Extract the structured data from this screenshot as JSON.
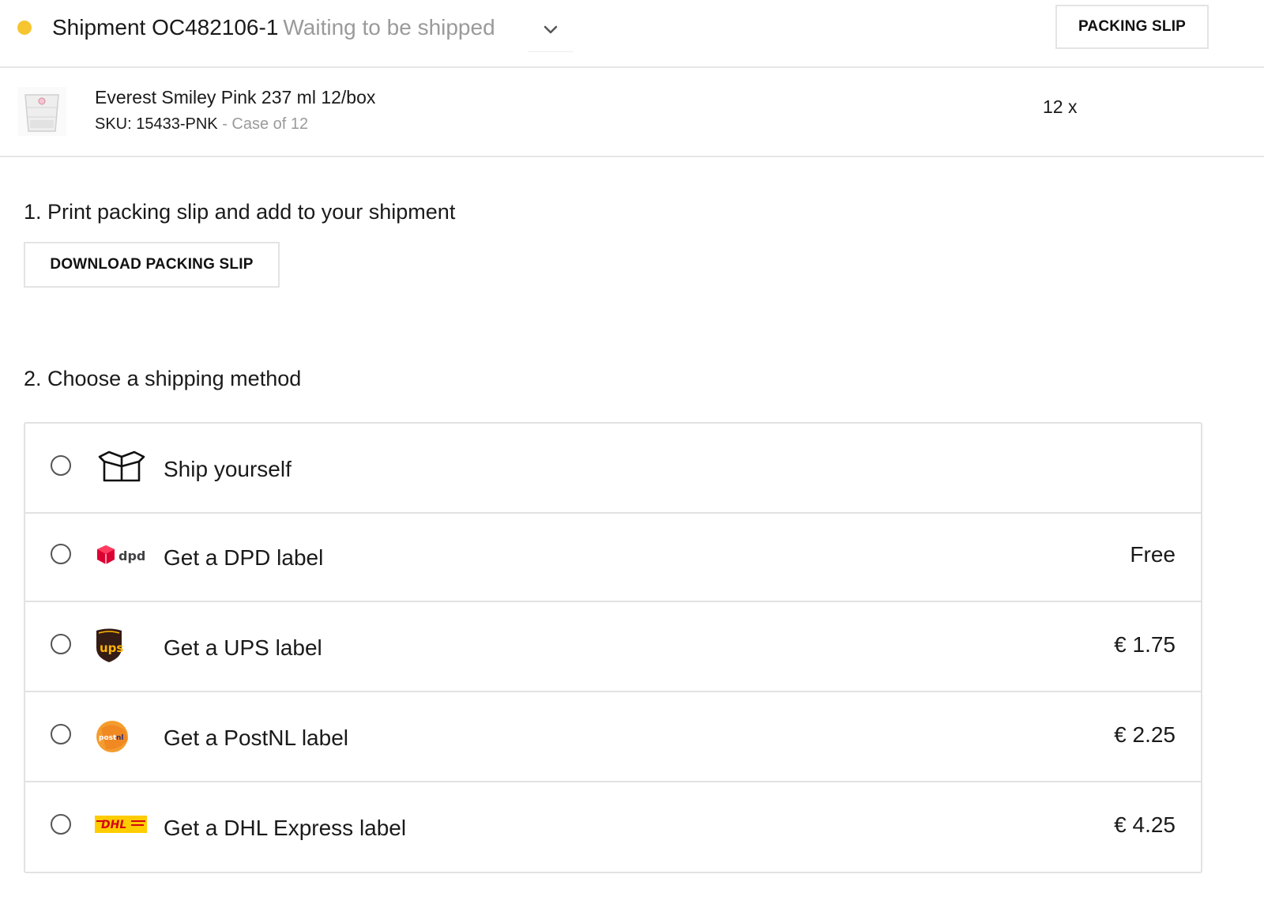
{
  "header": {
    "shipment_label": "Shipment OC482106-1",
    "status": "Waiting to be shipped",
    "status_color": "#f7c530",
    "packing_slip_button": "PACKING SLIP"
  },
  "product": {
    "name": "Everest Smiley Pink 237 ml 12/box",
    "sku": "SKU: 15433-PNK",
    "pack": " - Case of 12",
    "quantity": "12 x"
  },
  "steps": {
    "step1_title": "1. Print packing slip and add to your shipment",
    "download_button": "DOWNLOAD PACKING SLIP",
    "step2_title": "2. Choose a shipping method"
  },
  "shipping_options": [
    {
      "label": "Ship yourself",
      "price": "",
      "icon": "box-icon"
    },
    {
      "label": "Get a DPD label",
      "price": "Free",
      "icon": "dpd-logo"
    },
    {
      "label": "Get a UPS label",
      "price": "€ 1.75",
      "icon": "ups-logo"
    },
    {
      "label": "Get a PostNL label",
      "price": "€ 2.25",
      "icon": "postnl-logo"
    },
    {
      "label": "Get a DHL Express label",
      "price": "€ 4.25",
      "icon": "dhl-logo"
    }
  ]
}
